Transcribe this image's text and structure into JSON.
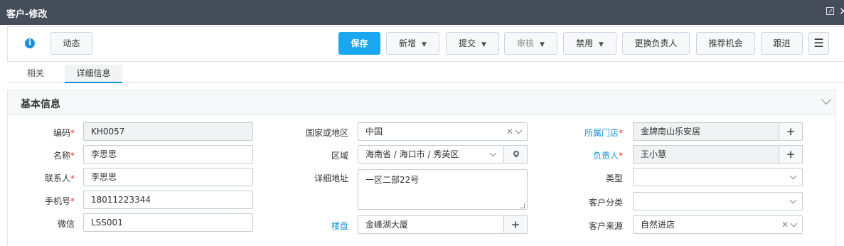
{
  "window": {
    "title": "客户-修改"
  },
  "toolbar": {
    "dynamic_label": "动态",
    "save_label": "保存",
    "add_label": "新增",
    "submit_label": "提交",
    "review_label": "审核",
    "disable_label": "禁用",
    "change_owner_label": "更换负责人",
    "recommend_label": "推荐机会",
    "follow_label": "跟进",
    "info_glyph": "i"
  },
  "tabs": [
    {
      "label": "相关"
    },
    {
      "label": "详细信息"
    }
  ],
  "section": {
    "title": "基本信息"
  },
  "form": {
    "code": {
      "label": "编码",
      "value": "KH0057"
    },
    "name": {
      "label": "名称",
      "value": "李思思"
    },
    "contact": {
      "label": "联系人",
      "value": "李思思"
    },
    "phone": {
      "label": "手机号",
      "value": "18011223344"
    },
    "wechat": {
      "label": "微信",
      "value": "LSS001"
    },
    "country": {
      "label": "国家或地区",
      "value": "中国"
    },
    "region": {
      "label": "区域",
      "value": "海南省 / 海口市 / 秀英区"
    },
    "address": {
      "label": "详细地址",
      "value": "一区二部22号"
    },
    "building": {
      "label": "楼盘",
      "value": "金峰湖大厦"
    },
    "store": {
      "label": "所属门店",
      "value": "金牌南山乐安居"
    },
    "owner": {
      "label": "负责人",
      "value": "王小慧"
    },
    "type": {
      "label": "类型",
      "value": ""
    },
    "category": {
      "label": "客户分类",
      "value": ""
    },
    "source": {
      "label": "客户来源",
      "value": "自然进店"
    }
  },
  "icons": {
    "maximize": "maximize-icon",
    "close": "close-icon",
    "info": "info-icon",
    "menu": "hamburger-menu-icon",
    "plus": "plus-icon",
    "location": "location-pin-icon",
    "chevron": "chevron-down-icon"
  },
  "colors": {
    "titlebar": "#444d59",
    "primary": "#1ba6f0",
    "link": "#1a91dc",
    "required": "#ee3333"
  }
}
